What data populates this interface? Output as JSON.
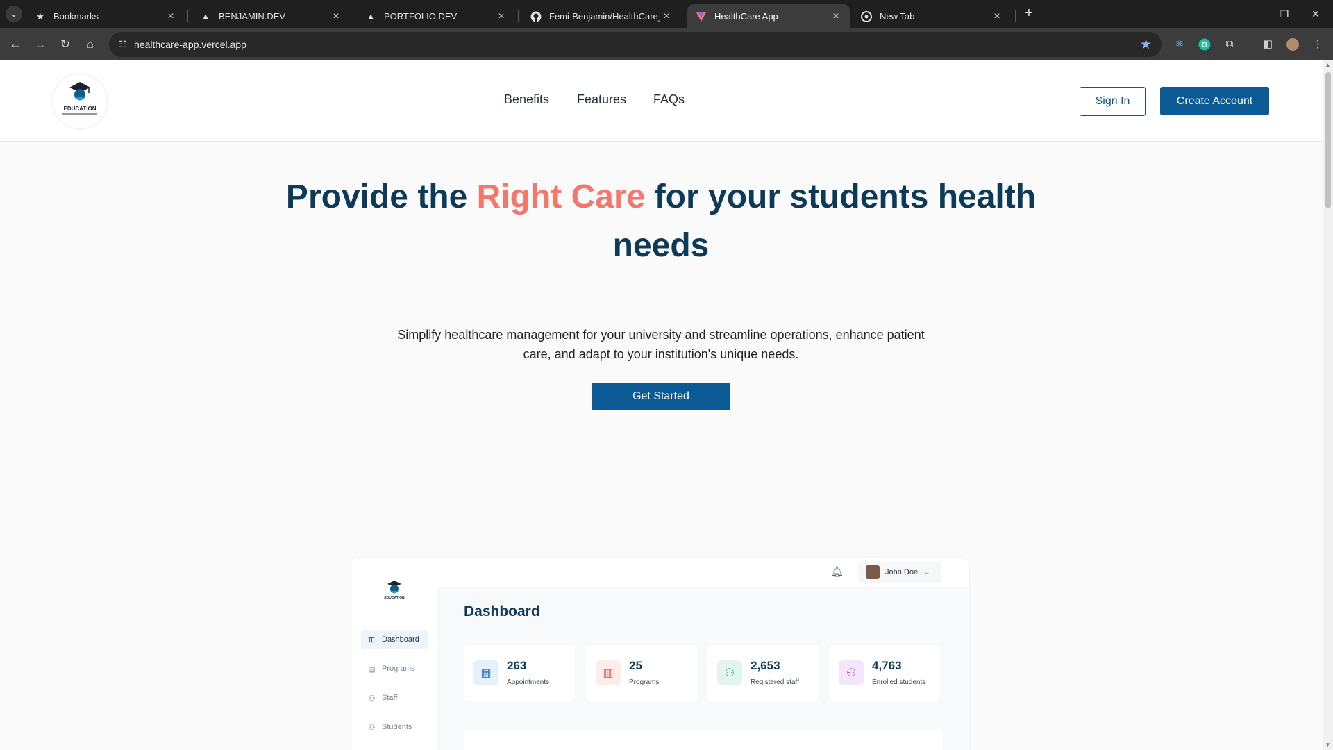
{
  "browser": {
    "tabs": [
      {
        "title": "Bookmarks",
        "icon": "star-icon"
      },
      {
        "title": "BENJAMIN.DEV",
        "icon": "vercel-icon"
      },
      {
        "title": "PORTFOLIO.DEV",
        "icon": "vercel-icon"
      },
      {
        "title": "Femi-Benjamin/HealthCare_App",
        "icon": "github-icon"
      },
      {
        "title": "HealthCare App",
        "icon": "healthcare-app-icon",
        "active": true
      },
      {
        "title": "New Tab",
        "icon": "chrome-icon"
      }
    ],
    "url": "healthcare-app.vercel.app"
  },
  "site": {
    "logo_text": "EDUCATION",
    "nav": [
      "Benefits",
      "Features",
      "FAQs"
    ],
    "sign_in": "Sign In",
    "create_account": "Create Account"
  },
  "hero": {
    "title_part1": "Provide the ",
    "title_accent": "Right Care",
    "title_part2": " for your students health needs",
    "subtitle": "Simplify healthcare management for your university and streamline operations, enhance patient care, and adapt to your institution's unique needs.",
    "cta": "Get Started"
  },
  "dashboard": {
    "logo_text": "EDUCATION",
    "user_name": "John Doe",
    "title": "Dashboard",
    "sidebar": [
      {
        "label": "Dashboard",
        "active": true
      },
      {
        "label": "Programs"
      },
      {
        "label": "Staff"
      },
      {
        "label": "Students"
      }
    ],
    "stats": [
      {
        "value": "263",
        "label": "Appointments",
        "icon": "calendar-icon",
        "color": "#e6f0fa"
      },
      {
        "value": "25",
        "label": "Programs",
        "icon": "bar-chart-icon",
        "color": "#fdecea"
      },
      {
        "value": "2,653",
        "label": "Registered staff",
        "icon": "users-icon",
        "color": "#e4f5ef"
      },
      {
        "value": "4,763",
        "label": "Enrolled students",
        "icon": "users-icon",
        "color": "#f3e6fa"
      }
    ]
  },
  "colors": {
    "primary": "#0b5a96",
    "heading": "#0d3a59",
    "accent": "#f5766b"
  }
}
